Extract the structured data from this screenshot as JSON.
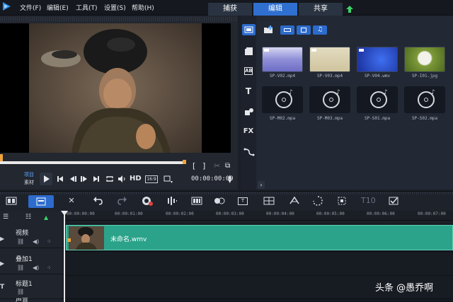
{
  "menu": [
    "文件(F)",
    "编辑(E)",
    "工具(T)",
    "设置(S)",
    "帮助(H)"
  ],
  "workspace_tabs": [
    {
      "label": "捕获",
      "active": false
    },
    {
      "label": "编辑",
      "active": true
    },
    {
      "label": "共享",
      "active": false
    }
  ],
  "preview": {
    "mode_project": "项目",
    "mode_clip": "素材",
    "hd_label": "HD",
    "aspect_label": "16:9",
    "timecode": "00:00:00:00"
  },
  "library": {
    "side_labels": [
      "T",
      "FX"
    ],
    "media": [
      {
        "name": "SP-V02.mp4",
        "kind": "video",
        "color": "#8f8fd8"
      },
      {
        "name": "SP-V03.mp4",
        "kind": "video",
        "color": "#d8cfae"
      },
      {
        "name": "SP-V04.wmv",
        "kind": "video",
        "color": "#1f3fb5"
      },
      {
        "name": "SP-I01.jpg",
        "kind": "image",
        "color": "#7e9a3a"
      },
      {
        "name": "SP-M02.mpa",
        "kind": "audio"
      },
      {
        "name": "SP-M03.mpa",
        "kind": "audio"
      },
      {
        "name": "SP-S01.mpa",
        "kind": "audio"
      },
      {
        "name": "SP-S02.mpa",
        "kind": "audio"
      }
    ]
  },
  "timeline": {
    "ruler": [
      "00:00:00:00",
      "00:00:01:00",
      "00:00:02:00",
      "00:00:03:00",
      "00:00:04:00",
      "00:00:05:00",
      "00:00:06:00",
      "00:00:07:00"
    ],
    "tracks": [
      {
        "name": "视频"
      },
      {
        "name": "叠加1"
      },
      {
        "name": "标题1"
      },
      {
        "name": "声音"
      }
    ],
    "clip_name": "未命名.wmv",
    "title_tool_label": "T",
    "subtitle_tool_label": "T10"
  },
  "watermark": "头条 @愚乔啊",
  "colors": {
    "accent": "#2f6fd0",
    "clip": "#2aa38a",
    "scrub": "#f2a33a"
  }
}
